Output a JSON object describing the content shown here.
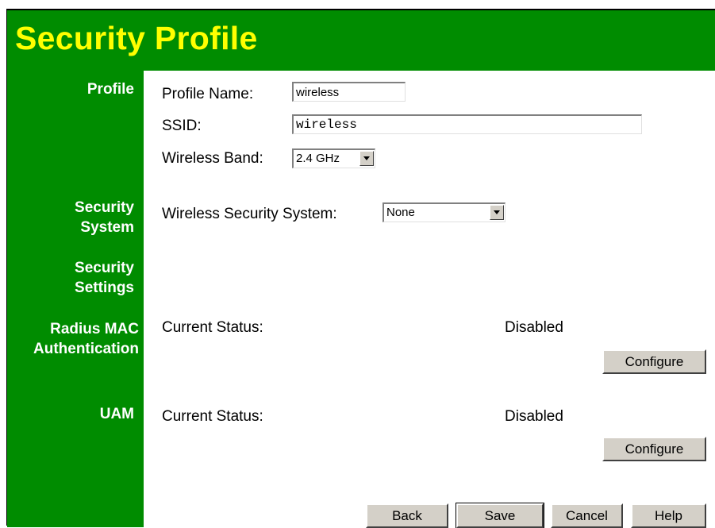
{
  "page": {
    "title": "Security Profile",
    "colors": {
      "header_bg": "#008c00",
      "title_text": "#ffff00",
      "sidebar_text": "#ffffff",
      "button_bg": "#d4d0c8"
    }
  },
  "sidebar": {
    "profile": "Profile",
    "security_system_line1": "Security",
    "security_system_line2": "System",
    "security_settings_line1": "Security",
    "security_settings_line2": "Settings",
    "radius_line1": "Radius MAC",
    "radius_line2": "Authentication",
    "uam": "UAM"
  },
  "profile": {
    "name_label": "Profile Name:",
    "name_value": "wireless",
    "ssid_label": "SSID:",
    "ssid_value": "wireless",
    "band_label": "Wireless Band:",
    "band_value": "2.4 GHz"
  },
  "security_system": {
    "label": "Wireless Security System:",
    "value": "None"
  },
  "radius_mac": {
    "status_label": "Current Status:",
    "status_value": "Disabled",
    "configure_label": "Configure"
  },
  "uam": {
    "status_label": "Current Status:",
    "status_value": "Disabled",
    "configure_label": "Configure"
  },
  "footer": {
    "back_label": "Back",
    "save_label": "Save",
    "cancel_label": "Cancel",
    "help_label": "Help"
  }
}
